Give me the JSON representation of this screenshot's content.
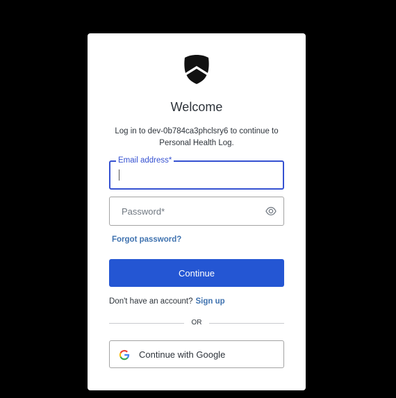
{
  "login": {
    "title": "Welcome",
    "subtitle": "Log in to dev-0b784ca3phclsry6 to continue to Personal Health Log.",
    "email": {
      "label": "Email address*",
      "value": ""
    },
    "password": {
      "placeholder": "Password*",
      "value": ""
    },
    "forgot_label": "Forgot password?",
    "continue_label": "Continue",
    "signup_prompt": "Don't have an account?",
    "signup_label": "Sign up",
    "divider_label": "OR",
    "google_label": "Continue with Google"
  },
  "icons": {
    "logo": "shield-logo-icon",
    "password_toggle": "eye-icon",
    "google": "google-icon"
  },
  "colors": {
    "background": "#000000",
    "card": "#ffffff",
    "primary": "#2456d3",
    "focus": "#3551d1",
    "link": "#3f72af"
  }
}
